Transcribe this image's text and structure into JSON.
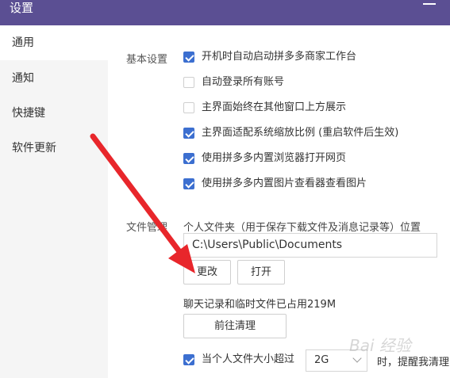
{
  "window": {
    "title": "设置"
  },
  "sidebar": {
    "items": [
      {
        "label": "通用"
      },
      {
        "label": "通知"
      },
      {
        "label": "快捷键"
      },
      {
        "label": "软件更新"
      }
    ]
  },
  "basic": {
    "section_label": "基本设置",
    "options": [
      {
        "label": "开机时自动启动拼多多商家工作台",
        "checked": true
      },
      {
        "label": "自动登录所有账号",
        "checked": false
      },
      {
        "label": "主界面始终在其他窗口上方展示",
        "checked": false
      },
      {
        "label": "主界面适配系统缩放比例 (重启软件后生效)",
        "checked": true
      },
      {
        "label": "使用拼多多内置浏览器打开网页",
        "checked": true
      },
      {
        "label": "使用拼多多内置图片查看器查看图片",
        "checked": true
      }
    ]
  },
  "files": {
    "section_label": "文件管理",
    "folder_desc": "个人文件夹（用于保存下载文件及消息记录等）位置",
    "path": "C:\\Users\\Public\\Documents",
    "change_button": "更改",
    "open_button": "打开",
    "usage_text": "聊天记录和临时文件已占用219M",
    "clean_button": "前往清理",
    "size_limit_prefix": "当个人文件大小超过",
    "size_value": "2G",
    "size_limit_suffix": "时，提醒我清理",
    "size_limit_checked": true
  },
  "watermark": {
    "text": "Bai 经验"
  },
  "colors": {
    "titlebar": "#5b4f93",
    "checkbox_checked": "#3c6fd0",
    "annotation_arrow": "#e8262b"
  }
}
